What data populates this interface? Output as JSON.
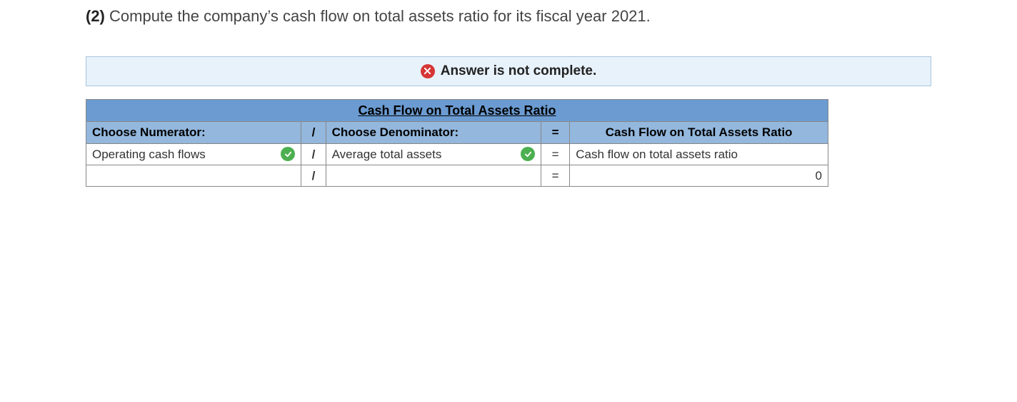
{
  "question": {
    "number": "(2)",
    "text": "Compute the company’s cash flow on total assets ratio for its fiscal year 2021."
  },
  "status": {
    "icon": "x",
    "label": "Answer is not complete."
  },
  "table": {
    "title": "Cash Flow on Total Assets Ratio",
    "headers": {
      "numerator": "Choose Numerator:",
      "slash": "/",
      "denominator": "Choose Denominator:",
      "equals": "=",
      "result": "Cash Flow on Total Assets Ratio"
    },
    "row1": {
      "numerator": "Operating cash flows",
      "numerator_correct": true,
      "slash": "/",
      "denominator": "Average total assets",
      "denominator_correct": true,
      "equals": "=",
      "result": "Cash flow on total assets ratio"
    },
    "row2": {
      "numerator": "",
      "slash": "/",
      "denominator": "",
      "equals": "=",
      "result": "0"
    }
  }
}
